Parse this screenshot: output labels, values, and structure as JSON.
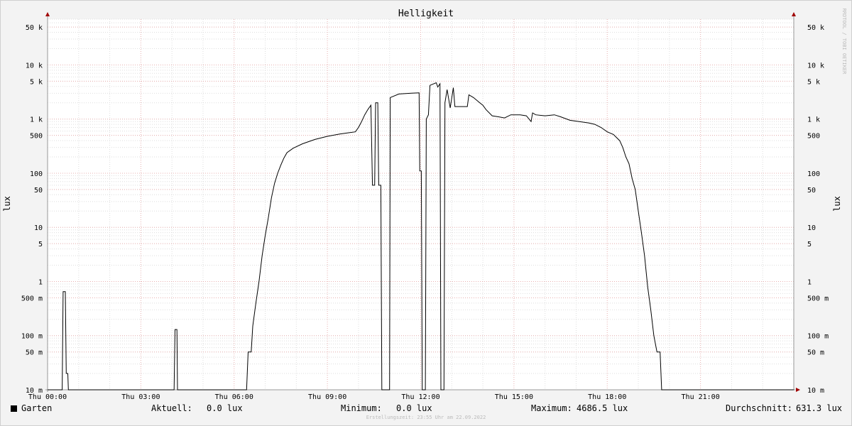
{
  "chart_data": {
    "type": "line",
    "title": "Helligkeit",
    "ylabel": "lux",
    "ylabel_right": "lux",
    "y_scale": "log",
    "ylim": [
      0.01,
      70000
    ],
    "y_ticks": [
      {
        "value": 50000,
        "label": "50 k"
      },
      {
        "value": 10000,
        "label": "10 k"
      },
      {
        "value": 5000,
        "label": "5 k"
      },
      {
        "value": 1000,
        "label": "1 k"
      },
      {
        "value": 500,
        "label": "500"
      },
      {
        "value": 100,
        "label": "100"
      },
      {
        "value": 50,
        "label": "50"
      },
      {
        "value": 10,
        "label": "10"
      },
      {
        "value": 5,
        "label": "5"
      },
      {
        "value": 1,
        "label": "1"
      },
      {
        "value": 0.5,
        "label": "500 m"
      },
      {
        "value": 0.1,
        "label": "100 m"
      },
      {
        "value": 0.05,
        "label": "50 m"
      },
      {
        "value": 0.01,
        "label": "10 m"
      }
    ],
    "xlim": [
      0,
      24
    ],
    "x_ticks": [
      {
        "value": 0,
        "label": "Thu 00:00"
      },
      {
        "value": 3,
        "label": "Thu 03:00"
      },
      {
        "value": 6,
        "label": "Thu 06:00"
      },
      {
        "value": 9,
        "label": "Thu 09:00"
      },
      {
        "value": 12,
        "label": "Thu 12:00"
      },
      {
        "value": 15,
        "label": "Thu 15:00"
      },
      {
        "value": 18,
        "label": "Thu 18:00"
      },
      {
        "value": 21,
        "label": "Thu 21:00"
      }
    ],
    "grid": true,
    "series": [
      {
        "name": "Garten",
        "color": "#000000",
        "points": [
          [
            0.0,
            0.01
          ],
          [
            0.47,
            0.01
          ],
          [
            0.5,
            0.65
          ],
          [
            0.57,
            0.65
          ],
          [
            0.6,
            0.02
          ],
          [
            0.65,
            0.02
          ],
          [
            0.67,
            0.01
          ],
          [
            4.07,
            0.01
          ],
          [
            4.1,
            0.13
          ],
          [
            4.16,
            0.13
          ],
          [
            4.18,
            0.01
          ],
          [
            6.4,
            0.01
          ],
          [
            6.45,
            0.05
          ],
          [
            6.55,
            0.05
          ],
          [
            6.6,
            0.15
          ],
          [
            6.7,
            0.4
          ],
          [
            6.8,
            1
          ],
          [
            6.9,
            3
          ],
          [
            7.0,
            7
          ],
          [
            7.1,
            15
          ],
          [
            7.2,
            35
          ],
          [
            7.3,
            65
          ],
          [
            7.4,
            100
          ],
          [
            7.5,
            140
          ],
          [
            7.6,
            190
          ],
          [
            7.7,
            240
          ],
          [
            7.9,
            290
          ],
          [
            8.2,
            350
          ],
          [
            8.6,
            420
          ],
          [
            9.0,
            480
          ],
          [
            9.4,
            530
          ],
          [
            9.7,
            560
          ],
          [
            9.9,
            580
          ],
          [
            10.0,
            700
          ],
          [
            10.1,
            900
          ],
          [
            10.2,
            1200
          ],
          [
            10.3,
            1500
          ],
          [
            10.4,
            1800
          ],
          [
            10.45,
            60
          ],
          [
            10.52,
            60
          ],
          [
            10.55,
            2000
          ],
          [
            10.62,
            2000
          ],
          [
            10.65,
            60
          ],
          [
            10.72,
            60
          ],
          [
            10.75,
            0.01
          ],
          [
            11.0,
            0.01
          ],
          [
            11.02,
            2500
          ],
          [
            11.3,
            2900
          ],
          [
            11.7,
            3000
          ],
          [
            11.95,
            3050
          ],
          [
            11.97,
            110
          ],
          [
            12.02,
            110
          ],
          [
            12.05,
            0.01
          ],
          [
            12.15,
            0.01
          ],
          [
            12.18,
            1000
          ],
          [
            12.25,
            1200
          ],
          [
            12.3,
            4200
          ],
          [
            12.5,
            4700
          ],
          [
            12.55,
            3900
          ],
          [
            12.62,
            4500
          ],
          [
            12.65,
            0.01
          ],
          [
            12.75,
            0.01
          ],
          [
            12.78,
            2000
          ],
          [
            12.85,
            3500
          ],
          [
            12.95,
            1600
          ],
          [
            13.05,
            3800
          ],
          [
            13.1,
            1700
          ],
          [
            13.3,
            1700
          ],
          [
            13.5,
            1700
          ],
          [
            13.55,
            2800
          ],
          [
            13.7,
            2500
          ],
          [
            13.9,
            2000
          ],
          [
            14.0,
            1800
          ],
          [
            14.1,
            1500
          ],
          [
            14.3,
            1150
          ],
          [
            14.5,
            1100
          ],
          [
            14.7,
            1050
          ],
          [
            14.9,
            1200
          ],
          [
            15.2,
            1200
          ],
          [
            15.4,
            1150
          ],
          [
            15.55,
            900
          ],
          [
            15.6,
            1300
          ],
          [
            15.7,
            1200
          ],
          [
            16.0,
            1150
          ],
          [
            16.3,
            1200
          ],
          [
            16.5,
            1100
          ],
          [
            16.8,
            950
          ],
          [
            17.1,
            900
          ],
          [
            17.4,
            850
          ],
          [
            17.6,
            800
          ],
          [
            17.8,
            700
          ],
          [
            18.0,
            580
          ],
          [
            18.2,
            520
          ],
          [
            18.4,
            400
          ],
          [
            18.5,
            300
          ],
          [
            18.6,
            200
          ],
          [
            18.7,
            150
          ],
          [
            18.8,
            80
          ],
          [
            18.9,
            50
          ],
          [
            19.0,
            20
          ],
          [
            19.1,
            8
          ],
          [
            19.2,
            3
          ],
          [
            19.3,
            0.8
          ],
          [
            19.4,
            0.3
          ],
          [
            19.5,
            0.1
          ],
          [
            19.6,
            0.05
          ],
          [
            19.7,
            0.05
          ],
          [
            19.75,
            0.01
          ],
          [
            24.0,
            0.01
          ]
        ]
      }
    ]
  },
  "branding": "RRDTOOL / TOBI OETIKER",
  "legend": {
    "series_name": "Garten",
    "aktuell_label": "Aktuell:",
    "aktuell_value": "0.0 lux",
    "minimum_label": "Minimum:",
    "minimum_value": "0.0 lux",
    "maximum_label": "Maximum:",
    "maximum_value": "4686.5 lux",
    "durchschnitt_label": "Durchschnitt:",
    "durchschnitt_value": "631.3 lux"
  },
  "footer": "Erstellungszeit: 23:55 Uhr am 22.09.2022"
}
